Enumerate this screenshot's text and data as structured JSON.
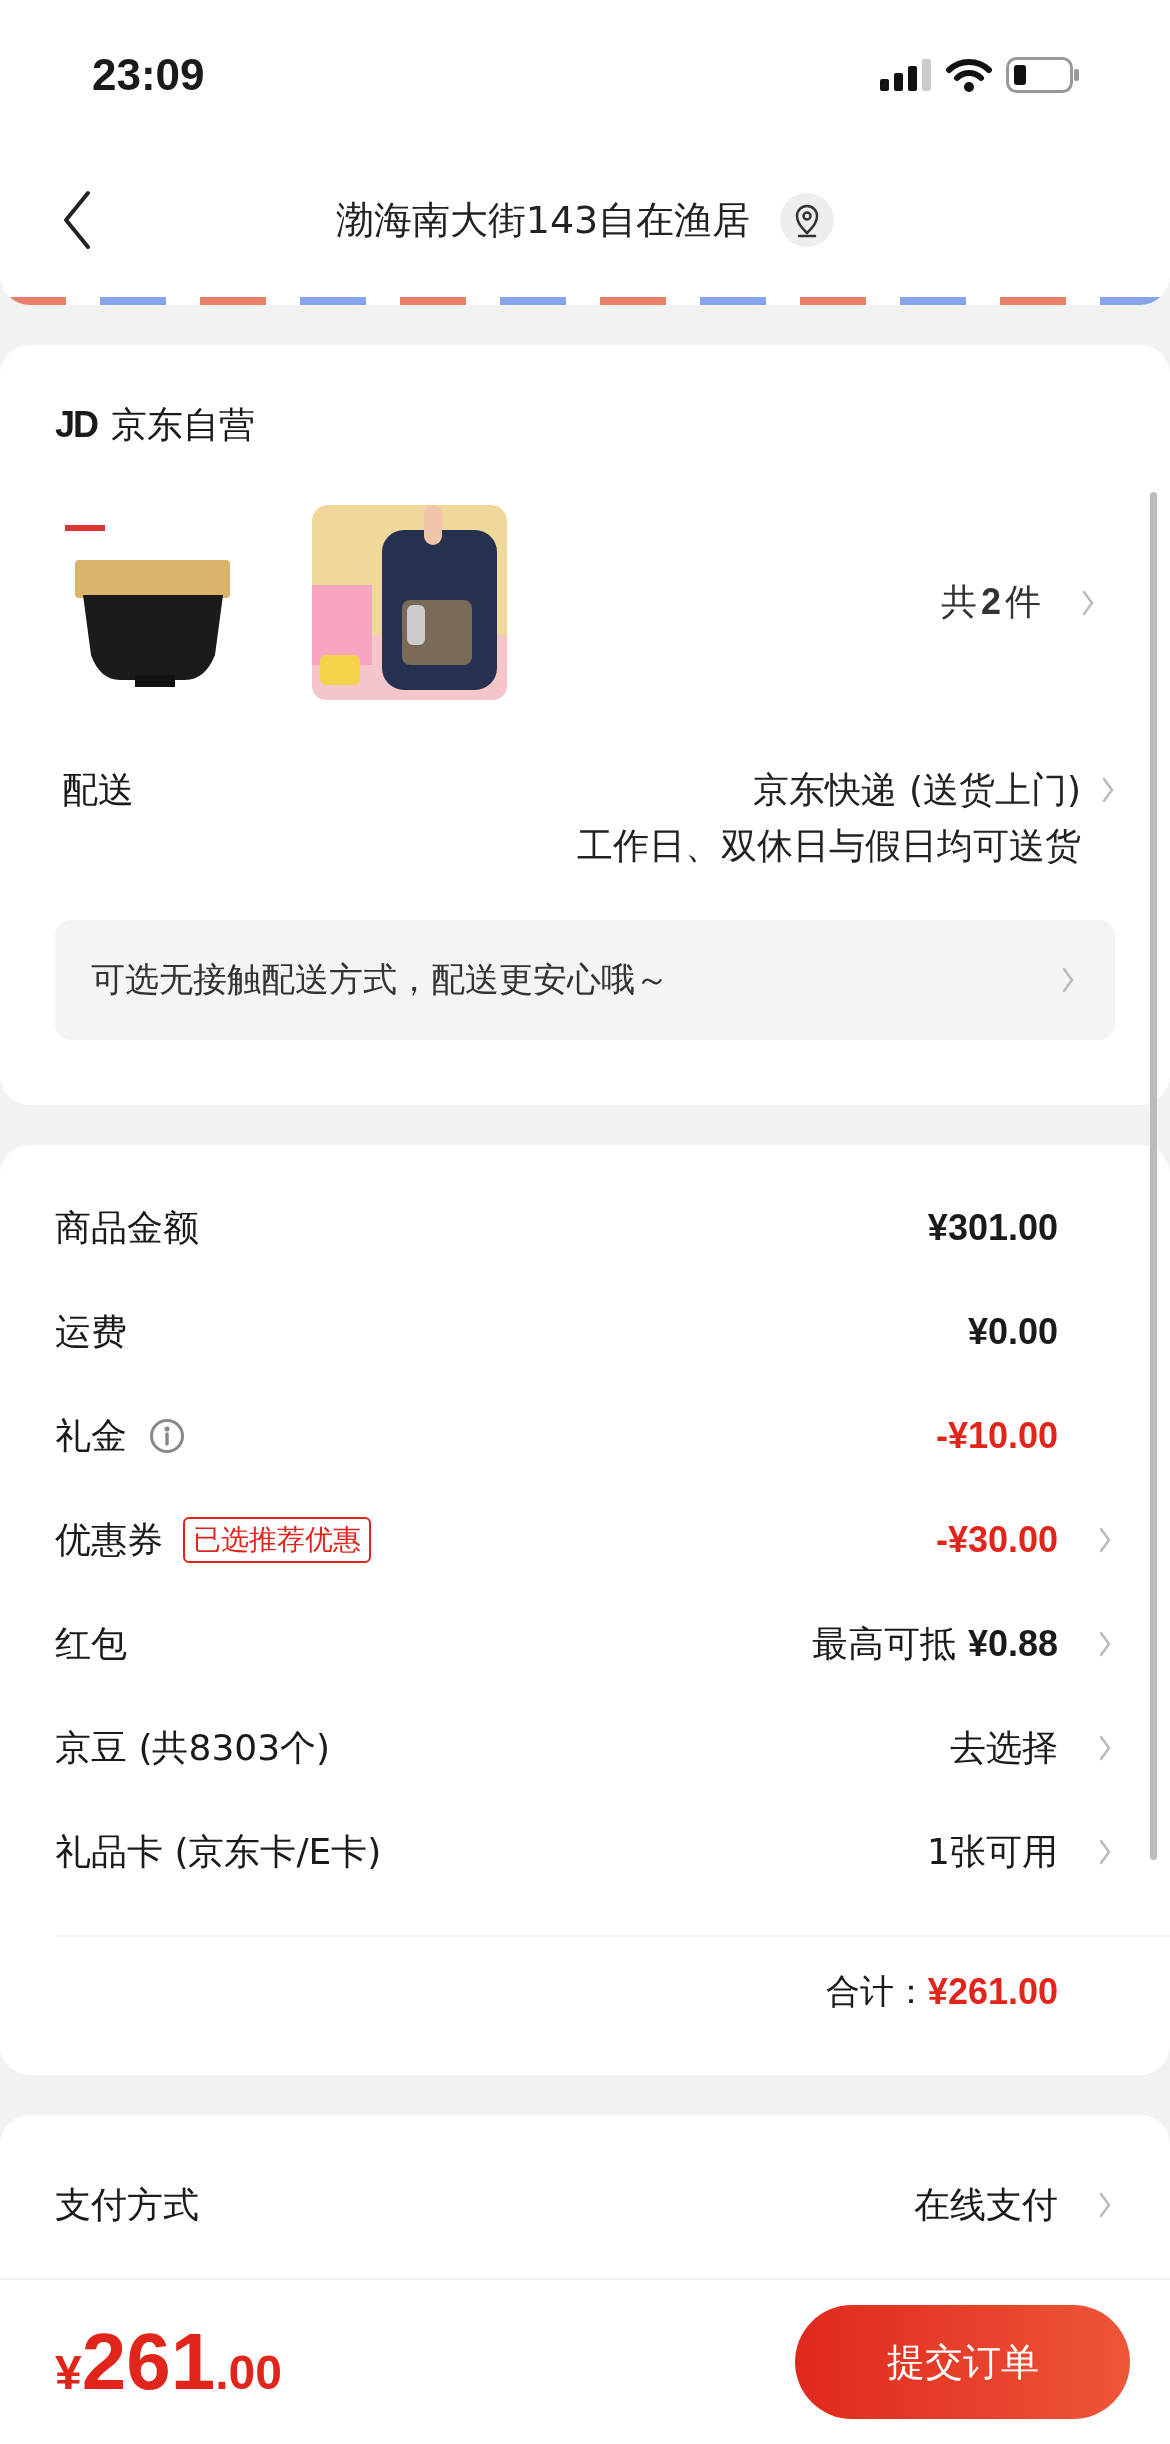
{
  "status_bar": {
    "time": "23:09"
  },
  "header": {
    "address": "渤海南大街143自在渔居"
  },
  "shop": {
    "logo": "JD",
    "name": "京东自营"
  },
  "item_count": {
    "prefix": "共",
    "count": "2",
    "suffix": "件"
  },
  "delivery": {
    "label": "配送",
    "method": "京东快递 (送货上门)",
    "schedule": "工作日、双休日与假日均可送货"
  },
  "notice": "可选无接触配送方式，配送更安心哦～",
  "price_rows": [
    {
      "label": "商品金额",
      "kind": "amount",
      "value": "¥301.00",
      "discount": false
    },
    {
      "label": "运费",
      "kind": "amount",
      "value": "¥0.00",
      "discount": false
    },
    {
      "label": "礼金",
      "kind": "amount",
      "value": "-¥10.00",
      "discount": true,
      "info": true
    },
    {
      "label": "优惠券",
      "kind": "amount",
      "value": "-¥30.00",
      "discount": true,
      "arrow": true,
      "tag": "已选推荐优惠"
    },
    {
      "label": "红包",
      "kind": "text",
      "value": "最高可抵 **¥0.88**",
      "discount": false,
      "arrow": true
    },
    {
      "label": "京豆 (共8303个)",
      "kind": "text",
      "value": "去选择",
      "discount": false,
      "arrow": true
    },
    {
      "label": "礼品卡 (京东卡/E卡)",
      "kind": "text",
      "value": "1张可用",
      "discount": false,
      "arrow": true
    }
  ],
  "subtotal": {
    "label": "合计：",
    "value": "¥261.00"
  },
  "payment": {
    "label": "支付方式",
    "value": "在线支付"
  },
  "footer": {
    "currency": "¥",
    "integer": "261",
    "decimal": ".00",
    "button": "提交订单"
  }
}
